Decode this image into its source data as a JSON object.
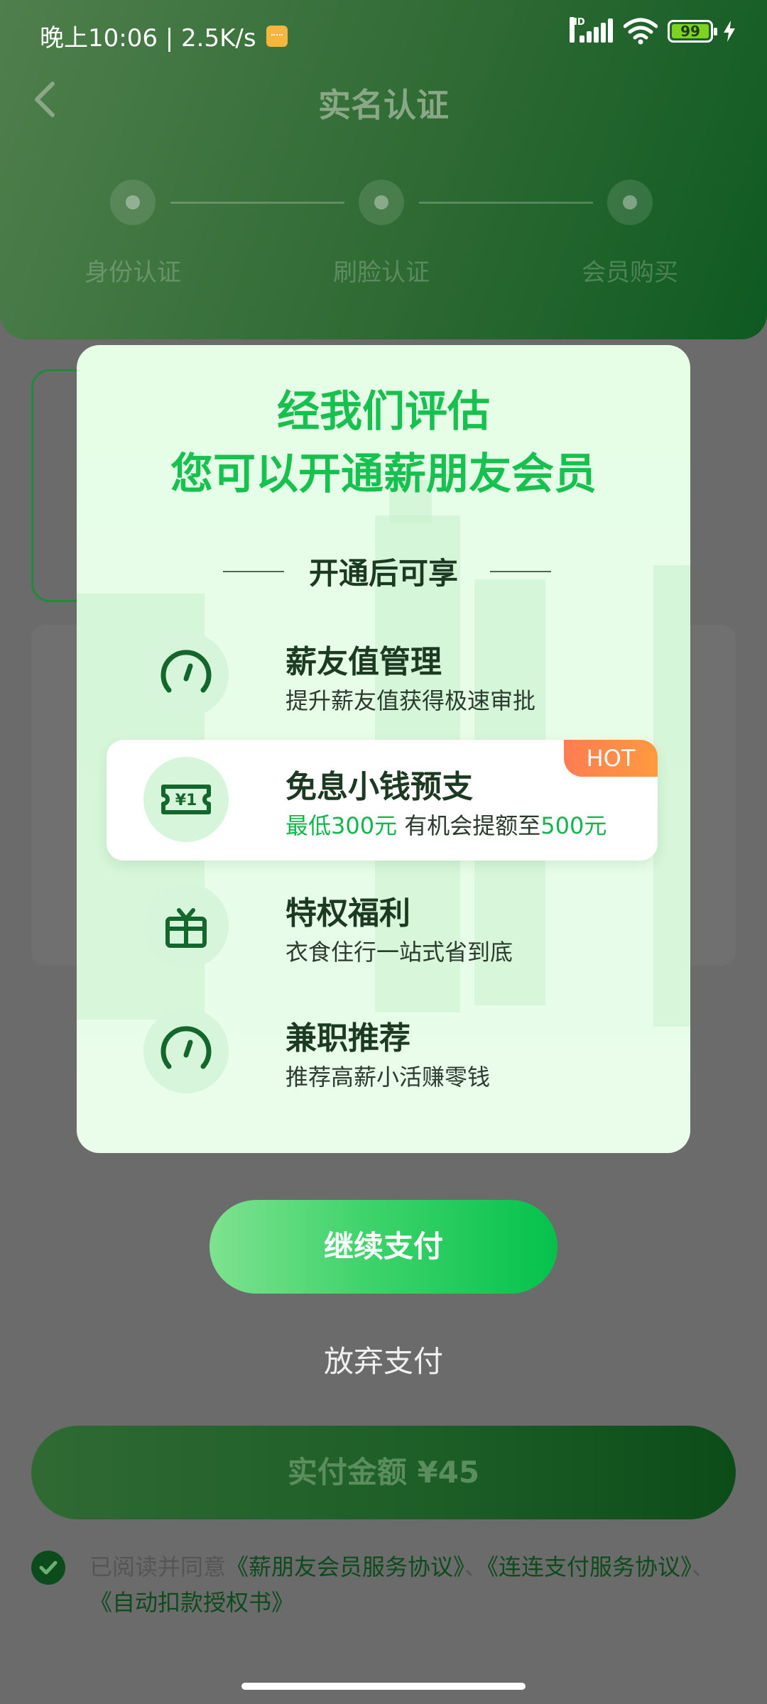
{
  "status_bar": {
    "time_speed": "晚上10:06 | 2.5K/s",
    "network_label": "HD",
    "battery": "99"
  },
  "page": {
    "title": "实名认证",
    "steps": [
      "身份认证",
      "刷脸认证",
      "会员购买"
    ]
  },
  "modal": {
    "title_line1": "经我们评估",
    "title_line2": "您可以开通薪朋友会员",
    "section_title": "开通后可享",
    "benefits": [
      {
        "name": "薪友值管理",
        "desc": "提升薪友值获得极速审批",
        "icon": "speedometer-icon"
      },
      {
        "name": "免息小钱预支",
        "desc_part1": "最低300元",
        "desc_part2": " 有机会提额至",
        "desc_part3": "500元",
        "badge": "HOT",
        "icon": "money-ticket-icon"
      },
      {
        "name": "特权福利",
        "desc": "衣食住行一站式省到底",
        "icon": "gift-icon"
      },
      {
        "name": "兼职推荐",
        "desc": "推荐高薪小活赚零钱",
        "icon": "speedometer-icon"
      }
    ]
  },
  "actions": {
    "continue_label": "继续支付",
    "abandon_label": "放弃支付",
    "pay_label": "实付金额 ¥45"
  },
  "agreement": {
    "prefix": "已阅读并同意",
    "link1": "《薪朋友会员服务协议》",
    "sep": "、",
    "link2": "《连连支付服务协议》",
    "sep2": "、",
    "link3": "《自动扣款授权书》"
  },
  "colors": {
    "brand_green": "#16c150",
    "dark_green": "#0b4c19",
    "hot_orange": "#ff7c52"
  }
}
